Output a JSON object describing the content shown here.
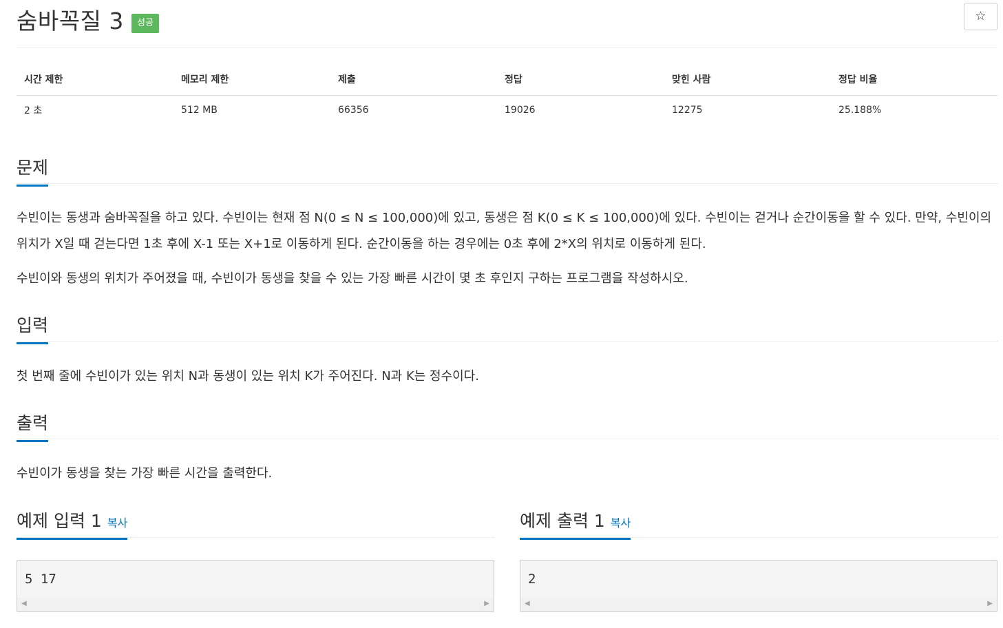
{
  "problem": {
    "title": "숨바꼭질 3",
    "status_badge": "성공",
    "star_icon": "☆"
  },
  "info": {
    "headers": [
      "시간 제한",
      "메모리 제한",
      "제출",
      "정답",
      "맞힌 사람",
      "정답 비율"
    ],
    "values": [
      "2 초",
      "512 MB",
      "66356",
      "19026",
      "12275",
      "25.188%"
    ]
  },
  "sections": {
    "description": {
      "heading": "문제",
      "paragraphs": [
        "수빈이는 동생과 숨바꼭질을 하고 있다. 수빈이는 현재 점 N(0 ≤ N ≤ 100,000)에 있고, 동생은 점 K(0 ≤ K ≤ 100,000)에 있다. 수빈이는 걷거나 순간이동을 할 수 있다. 만약, 수빈이의 위치가 X일 때 걷는다면 1초 후에 X-1 또는 X+1로 이동하게 된다. 순간이동을 하는 경우에는 0초 후에 2*X의 위치로 이동하게 된다.",
        "수빈이와 동생의 위치가 주어졌을 때, 수빈이가 동생을 찾을 수 있는 가장 빠른 시간이 몇 초 후인지 구하는 프로그램을 작성하시오."
      ]
    },
    "input": {
      "heading": "입력",
      "text": "첫 번째 줄에 수빈이가 있는 위치 N과 동생이 있는 위치 K가 주어진다. N과 K는 정수이다."
    },
    "output": {
      "heading": "출력",
      "text": "수빈이가 동생을 찾는 가장 빠른 시간을 출력한다."
    }
  },
  "samples": {
    "input_heading": "예제 입력 1",
    "output_heading": "예제 출력 1",
    "copy_label": "복사",
    "input_value": "5 17",
    "output_value": "2"
  },
  "colors": {
    "accent": "#0076c0",
    "badge": "#5cb85c"
  }
}
